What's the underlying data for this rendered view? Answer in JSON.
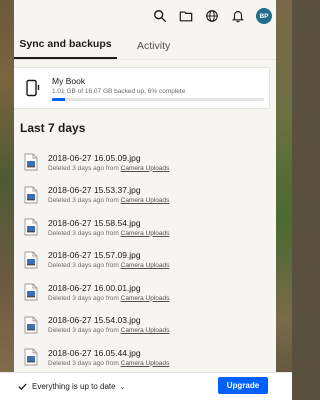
{
  "header": {
    "avatar_initials": "BP",
    "icons": [
      "search-icon",
      "folder-icon",
      "globe-icon",
      "bell-icon"
    ]
  },
  "tabs": [
    {
      "label": "Sync and backups",
      "active": true
    },
    {
      "label": "Activity",
      "active": false
    }
  ],
  "device": {
    "name": "My Book",
    "status": "1.01 GB of 16.07 GB backed up, 6% complete",
    "progress": 0.06
  },
  "section_title": "Last 7 days",
  "files": [
    {
      "name": "2018-06-27 16.05.09.jpg",
      "meta": "Deleted 3 days ago from ",
      "folder": "Camera Uploads"
    },
    {
      "name": "2018-06-27 15.53.37.jpg",
      "meta": "Deleted 3 days ago from ",
      "folder": "Camera Uploads"
    },
    {
      "name": "2018-06-27 15.58.54.jpg",
      "meta": "Deleted 3 days ago from ",
      "folder": "Camera Uploads"
    },
    {
      "name": "2018-06-27 15.57.09.jpg",
      "meta": "Deleted 3 days ago from ",
      "folder": "Camera Uploads"
    },
    {
      "name": "2018-06-27 16.00.01.jpg",
      "meta": "Deleted 3 days ago from ",
      "folder": "Camera Uploads"
    },
    {
      "name": "2018-06-27 15.54.03.jpg",
      "meta": "Deleted 3 days ago from ",
      "folder": "Camera Uploads"
    },
    {
      "name": "2018-06-27 16.05.44.jpg",
      "meta": "Deleted 3 days ago from ",
      "folder": "Camera Uploads"
    }
  ],
  "footer": {
    "status": "Everything is up to date",
    "upgrade_label": "Upgrade"
  },
  "colors": {
    "accent": "#0061fe",
    "avatar": "#1f6f8b"
  }
}
